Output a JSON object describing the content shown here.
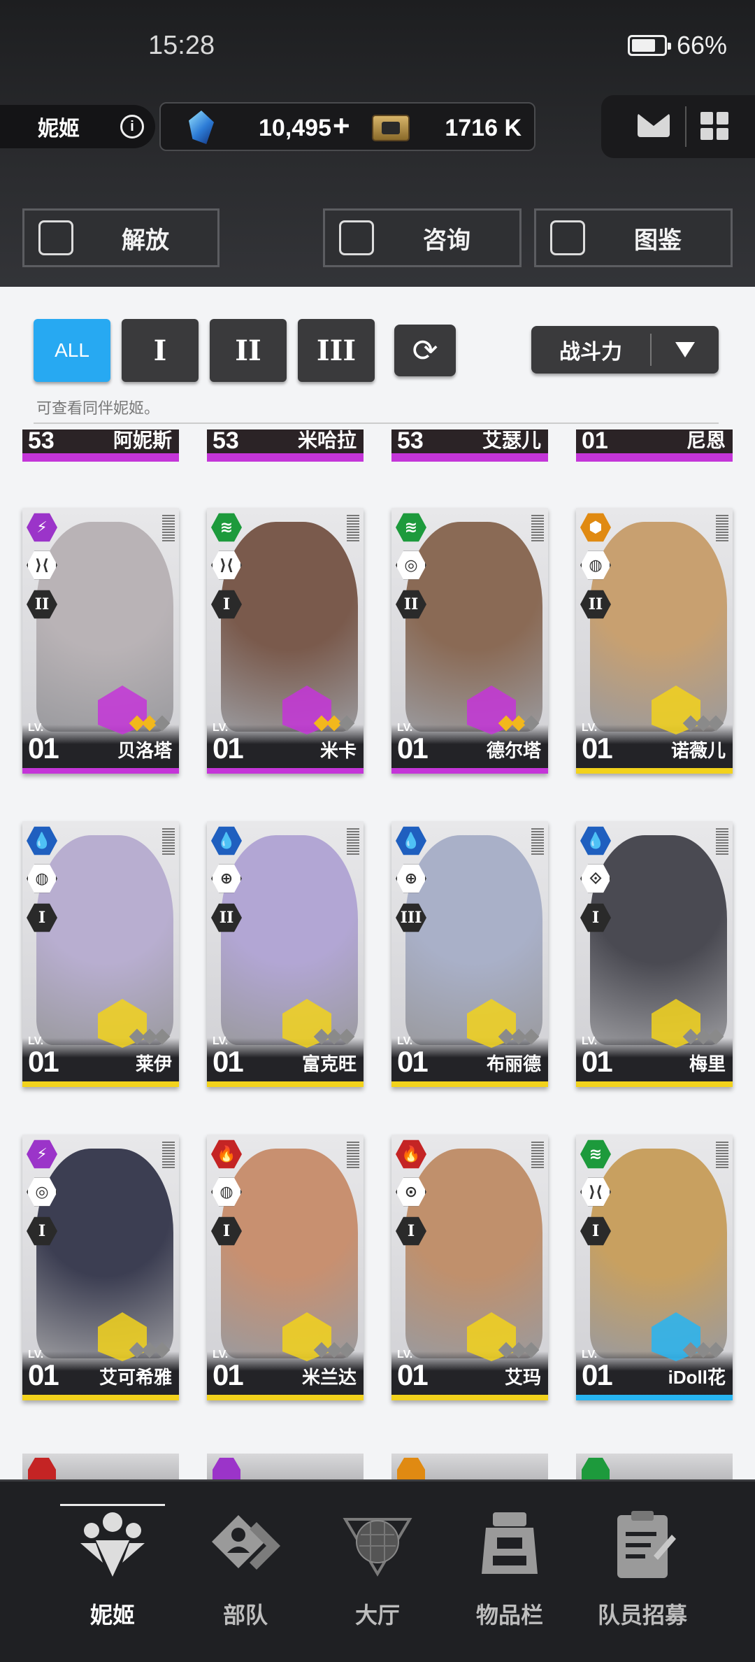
{
  "status": {
    "time": "15:28",
    "battery": "66%",
    "battery_level": 0.66
  },
  "header": {
    "section": "妮姬",
    "info_icon": "info-icon",
    "gems": "10,495",
    "gems_plus": "+",
    "credits": "1716 K"
  },
  "top_buttons": [
    {
      "label": "解放",
      "icon": "limit-break-icon"
    },
    {
      "label": "咨询",
      "icon": "calendar-star-icon"
    },
    {
      "label": "图鉴",
      "icon": "codex-icon"
    }
  ],
  "filters": {
    "all": "ALL",
    "burst": [
      "I",
      "II",
      "III"
    ],
    "refresh_icon": "refresh-icon",
    "sort_label": "战斗力",
    "hint": "可查看同伴妮姬。"
  },
  "top_row": [
    {
      "lv": "53",
      "name": "阿妮斯",
      "rarity_color": "#c435d8"
    },
    {
      "lv": "53",
      "name": "米哈拉",
      "rarity_color": "#c435d8"
    },
    {
      "lv": "53",
      "name": "艾瑟儿",
      "rarity_color": "#c435d8"
    },
    {
      "lv": "01",
      "name": "尼恩",
      "rarity_color": "#c435d8"
    }
  ],
  "cards": [
    {
      "name": "贝洛塔",
      "lv_label": "LV.",
      "lv": "01",
      "element_color": "#9b34c9",
      "element_icon": "electric-icon",
      "element_glyph": "⚡",
      "role_glyph": "⟩⟨",
      "burst": "II",
      "rarity_color": "#c435d8",
      "stars_filled": 2,
      "portrait": "#b9b3b6"
    },
    {
      "name": "米卡",
      "lv_label": "LV.",
      "lv": "01",
      "element_color": "#1d9a3c",
      "element_icon": "wind-icon",
      "element_glyph": "≋",
      "role_glyph": "⟩⟨",
      "burst": "I",
      "rarity_color": "#c435d8",
      "stars_filled": 2,
      "portrait": "#7a5a4c"
    },
    {
      "name": "德尔塔",
      "lv_label": "LV.",
      "lv": "01",
      "element_color": "#1d9a3c",
      "element_icon": "wind-icon",
      "element_glyph": "≋",
      "role_glyph": "◎",
      "burst": "II",
      "rarity_color": "#c435d8",
      "stars_filled": 2,
      "portrait": "#8a6a55"
    },
    {
      "name": "诺薇儿",
      "lv_label": "LV.",
      "lv": "01",
      "element_color": "#e08a12",
      "element_icon": "iron-icon",
      "element_glyph": "⬢",
      "role_glyph": "◍",
      "burst": "II",
      "rarity_color": "#f2d21c",
      "stars_filled": 0,
      "portrait": "#c8a070"
    },
    {
      "name": "莱伊",
      "lv_label": "LV.",
      "lv": "01",
      "element_color": "#1f5fbf",
      "element_icon": "water-icon",
      "element_glyph": "💧",
      "role_glyph": "◍",
      "burst": "I",
      "rarity_color": "#f2d21c",
      "stars_filled": 0,
      "portrait": "#b8aed0"
    },
    {
      "name": "富克旺",
      "lv_label": "LV.",
      "lv": "01",
      "element_color": "#1f5fbf",
      "element_icon": "water-icon",
      "element_glyph": "💧",
      "role_glyph": "⊕",
      "burst": "II",
      "rarity_color": "#f2d21c",
      "stars_filled": 0,
      "portrait": "#b2a6d4"
    },
    {
      "name": "布丽德",
      "lv_label": "LV.",
      "lv": "01",
      "element_color": "#1f5fbf",
      "element_icon": "water-icon",
      "element_glyph": "💧",
      "role_glyph": "⊕",
      "burst": "III",
      "rarity_color": "#f2d21c",
      "stars_filled": 0,
      "portrait": "#a9b0c8"
    },
    {
      "name": "梅里",
      "lv_label": "LV.",
      "lv": "01",
      "element_color": "#1f5fbf",
      "element_icon": "water-icon",
      "element_glyph": "💧",
      "role_glyph": "⟐",
      "burst": "I",
      "rarity_color": "#f2d21c",
      "stars_filled": 0,
      "portrait": "#4a4a52"
    },
    {
      "name": "艾可希雅",
      "lv_label": "LV.",
      "lv": "01",
      "element_color": "#9b34c9",
      "element_icon": "electric-icon",
      "element_glyph": "⚡",
      "role_glyph": "◎",
      "burst": "I",
      "rarity_color": "#f2d21c",
      "stars_filled": 0,
      "portrait": "#3c3e52"
    },
    {
      "name": "米兰达",
      "lv_label": "LV.",
      "lv": "01",
      "element_color": "#c42424",
      "element_icon": "fire-icon",
      "element_glyph": "🔥",
      "role_glyph": "◍",
      "burst": "I",
      "rarity_color": "#f2d21c",
      "stars_filled": 0,
      "portrait": "#c89070"
    },
    {
      "name": "艾玛",
      "lv_label": "LV.",
      "lv": "01",
      "element_color": "#c42424",
      "element_icon": "fire-icon",
      "element_glyph": "🔥",
      "role_glyph": "⊙",
      "burst": "I",
      "rarity_color": "#f2d21c",
      "stars_filled": 0,
      "portrait": "#c0906c"
    },
    {
      "name": "iDoll花",
      "lv_label": "LV.",
      "lv": "01",
      "element_color": "#1d9a3c",
      "element_icon": "wind-icon",
      "element_glyph": "≋",
      "role_glyph": "⟩⟨",
      "burst": "I",
      "rarity_color": "#27b5f2",
      "stars_filled": 0,
      "portrait": "#c8a060"
    }
  ],
  "peek_row": [
    {
      "element_color": "#c42424"
    },
    {
      "element_color": "#9b34c9"
    },
    {
      "element_color": "#e08a12"
    },
    {
      "element_color": "#1d9a3c"
    }
  ],
  "nav": [
    {
      "label": "妮姬",
      "icon": "nikke-icon",
      "active": true
    },
    {
      "label": "部队",
      "icon": "squad-icon",
      "active": false
    },
    {
      "label": "大厅",
      "icon": "lobby-icon",
      "active": false
    },
    {
      "label": "物品栏",
      "icon": "inventory-icon",
      "active": false
    },
    {
      "label": "队员招募",
      "icon": "recruit-icon",
      "active": false
    }
  ]
}
